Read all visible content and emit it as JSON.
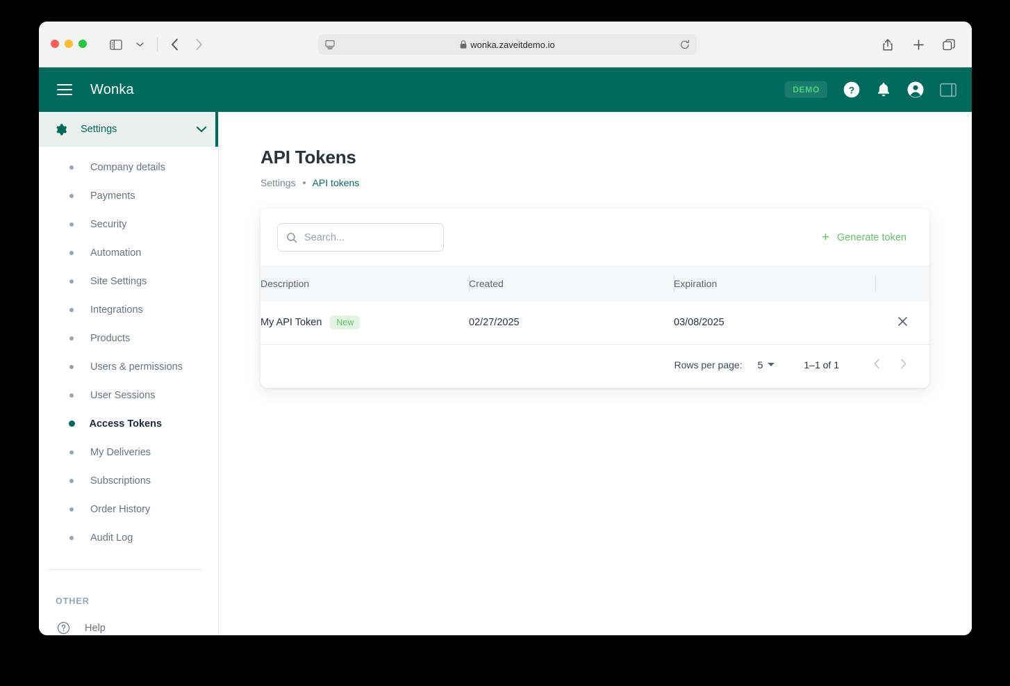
{
  "browser": {
    "url": "wonka.zaveitdemo.io",
    "icons": {
      "sidebar_toggle": "sidebar-toggle-icon",
      "tab_overview_chevron": "chevron-down-icon",
      "back": "back-arrow-icon",
      "forward": "forward-arrow-icon",
      "reader": "reader-view-icon",
      "lock": "lock-icon",
      "reload": "reload-icon",
      "share": "share-icon",
      "new_tab": "plus-icon",
      "tabs": "tabs-overview-icon"
    }
  },
  "appbar": {
    "brand": "Wonka",
    "demo_badge": "DEMO",
    "bg_color": "#006a5e",
    "badge_text_color": "#4cd07d"
  },
  "sidebar": {
    "section": {
      "label": "Settings",
      "icon": "gear-icon",
      "expanded_icon": "chevron-down-icon",
      "accent_color": "#00695c"
    },
    "items": [
      {
        "label": "Company details",
        "active": false
      },
      {
        "label": "Payments",
        "active": false
      },
      {
        "label": "Security",
        "active": false
      },
      {
        "label": "Automation",
        "active": false
      },
      {
        "label": "Site Settings",
        "active": false
      },
      {
        "label": "Integrations",
        "active": false
      },
      {
        "label": "Products",
        "active": false
      },
      {
        "label": "Users & permissions",
        "active": false
      },
      {
        "label": "User Sessions",
        "active": false
      },
      {
        "label": "Access Tokens",
        "active": true
      },
      {
        "label": "My Deliveries",
        "active": false
      },
      {
        "label": "Subscriptions",
        "active": false
      },
      {
        "label": "Order History",
        "active": false
      },
      {
        "label": "Audit Log",
        "active": false
      }
    ],
    "other": {
      "heading": "OTHER",
      "help_label": "Help",
      "help_icon": "question-circle-icon"
    }
  },
  "main": {
    "title": "API Tokens",
    "breadcrumb": {
      "parent": "Settings",
      "current": "API tokens"
    },
    "search": {
      "placeholder": "Search...",
      "value": ""
    },
    "generate_button": {
      "label": "Generate token",
      "color": "#63c163"
    },
    "table": {
      "columns": [
        "Description",
        "Created",
        "Expiration",
        ""
      ],
      "rows": [
        {
          "description": "My API Token",
          "badge": "New",
          "created": "02/27/2025",
          "expiration": "03/08/2025",
          "delete_icon": "close-icon"
        }
      ]
    },
    "pagination": {
      "rows_per_page_label": "Rows per page:",
      "rows_per_page_value": "5",
      "range": "1–1 of 1"
    }
  }
}
